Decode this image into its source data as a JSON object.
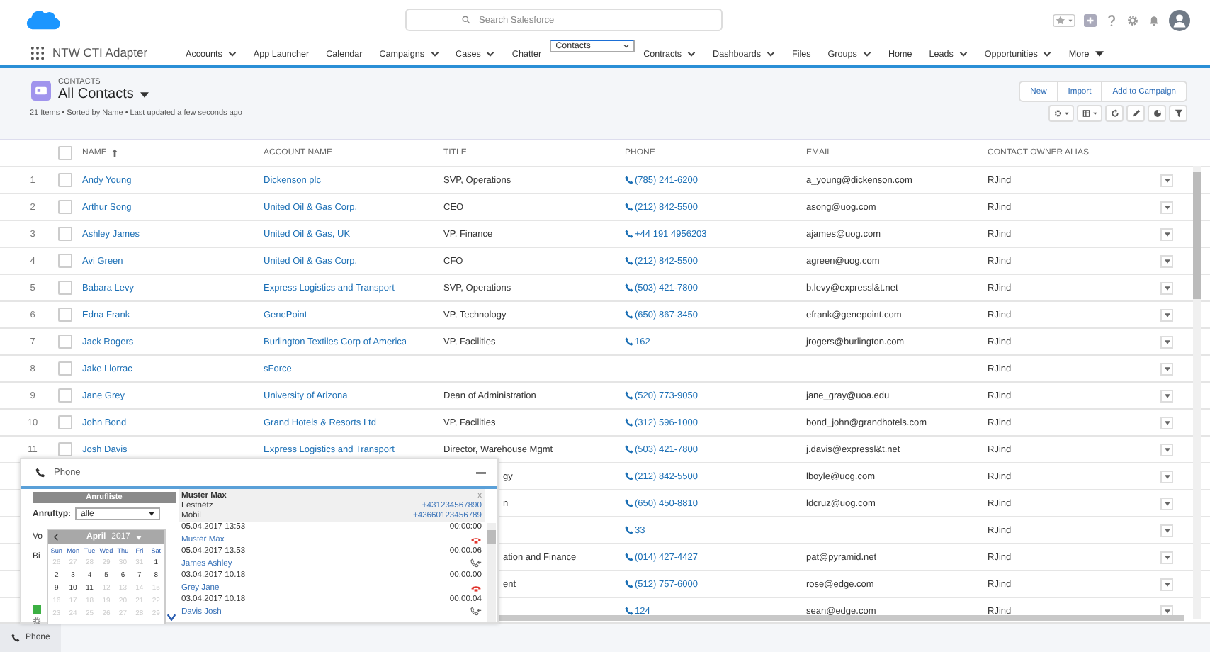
{
  "header": {
    "search": {
      "placeholder": "Search Salesforce"
    }
  },
  "nav": {
    "app_name": "NTW CTI Adapter",
    "items": [
      {
        "label": "Accounts",
        "menu": true,
        "selected": false
      },
      {
        "label": "App Launcher",
        "menu": false,
        "selected": false
      },
      {
        "label": "Calendar",
        "menu": false,
        "selected": false
      },
      {
        "label": "Campaigns",
        "menu": true,
        "selected": false
      },
      {
        "label": "Cases",
        "menu": true,
        "selected": false
      },
      {
        "label": "Chatter",
        "menu": false,
        "selected": false
      },
      {
        "label": "Contacts",
        "menu": true,
        "selected": true
      },
      {
        "label": "Contracts",
        "menu": true,
        "selected": false
      },
      {
        "label": "Dashboards",
        "menu": true,
        "selected": false
      },
      {
        "label": "Files",
        "menu": false,
        "selected": false
      },
      {
        "label": "Groups",
        "menu": true,
        "selected": false
      },
      {
        "label": "Home",
        "menu": false,
        "selected": false
      },
      {
        "label": "Leads",
        "menu": true,
        "selected": false
      },
      {
        "label": "Opportunities",
        "menu": true,
        "selected": false
      }
    ],
    "more": "More"
  },
  "list_header": {
    "object": "CONTACTS",
    "view": "All Contacts",
    "buttons": [
      "New",
      "Import",
      "Add to Campaign"
    ],
    "summary": "21 Items • Sorted by Name • Last updated a few seconds ago"
  },
  "table": {
    "columns": [
      "NAME",
      "ACCOUNT NAME",
      "TITLE",
      "PHONE",
      "EMAIL",
      "CONTACT OWNER ALIAS"
    ],
    "select_all_checked": false,
    "rows": [
      {
        "num": "1",
        "name": "Andy Young",
        "account": "Dickenson plc",
        "title": "SVP, Operations",
        "phone": "(785) 241-6200",
        "email": "a_young@dickenson.com",
        "alias": "RJind",
        "checked": false
      },
      {
        "num": "2",
        "name": "Arthur Song",
        "account": "United Oil & Gas Corp.",
        "title": "CEO",
        "phone": "(212) 842-5500",
        "email": "asong@uog.com",
        "alias": "RJind",
        "checked": false
      },
      {
        "num": "3",
        "name": "Ashley James",
        "account": "United Oil & Gas, UK",
        "title": "VP, Finance",
        "phone": "+44 191 4956203",
        "email": "ajames@uog.com",
        "alias": "RJind",
        "checked": false
      },
      {
        "num": "4",
        "name": "Avi Green",
        "account": "United Oil & Gas Corp.",
        "title": "CFO",
        "phone": "(212) 842-5500",
        "email": "agreen@uog.com",
        "alias": "RJind",
        "checked": false
      },
      {
        "num": "5",
        "name": "Babara Levy",
        "account": "Express Logistics and Transport",
        "title": "SVP, Operations",
        "phone": "(503) 421-7800",
        "email": "b.levy@expressl&t.net",
        "alias": "RJind",
        "checked": false
      },
      {
        "num": "6",
        "name": "Edna Frank",
        "account": "GenePoint",
        "title": "VP, Technology",
        "phone": "(650) 867-3450",
        "email": "efrank@genepoint.com",
        "alias": "RJind",
        "checked": false
      },
      {
        "num": "7",
        "name": "Jack Rogers",
        "account": "Burlington Textiles Corp of America",
        "title": "VP, Facilities",
        "phone": "162",
        "email": "jrogers@burlington.com",
        "alias": "RJind",
        "checked": false
      },
      {
        "num": "8",
        "name": "Jake Llorrac",
        "account": "sForce",
        "alias": "RJind",
        "checked": false
      },
      {
        "num": "9",
        "name": "Jane Grey",
        "account": "University of Arizona",
        "title": "Dean of Administration",
        "phone": "(520) 773-9050",
        "email": "jane_gray@uoa.edu",
        "alias": "RJind",
        "checked": false
      },
      {
        "num": "10",
        "name": "John Bond",
        "account": "Grand Hotels & Resorts Ltd",
        "title": "VP, Facilities",
        "phone": "(312) 596-1000",
        "email": "bond_john@grandhotels.com",
        "alias": "RJind",
        "checked": false
      },
      {
        "num": "11",
        "name": "Josh Davis",
        "account": "Express Logistics and Transport",
        "title": "Director, Warehouse Mgmt",
        "phone": "(503) 421-7800",
        "email": "j.davis@expressl&t.net",
        "alias": "RJind",
        "checked": false
      },
      {
        "title": "gy",
        "phone": "(212) 842-5500",
        "email": "lboyle@uog.com",
        "alias": "RJind"
      },
      {
        "title": "n",
        "phone": "(650) 450-8810",
        "email": "ldcruz@uog.com",
        "alias": "RJind"
      },
      {
        "phone": "33",
        "alias": "RJind"
      },
      {
        "title": "ation and Finance",
        "phone": "(014) 427-4427",
        "email": "pat@pyramid.net",
        "alias": "RJind"
      },
      {
        "title": "ent",
        "phone": "(512) 757-6000",
        "email": "rose@edge.com",
        "alias": "RJind"
      },
      {
        "phone": "124",
        "email": "sean@edge.com",
        "alias": "RJind"
      }
    ]
  },
  "phone_panel": {
    "title": "Phone",
    "call_list": {
      "title": "Anrufliste",
      "type_label": "Anruftyp:",
      "type_value": "alle",
      "from_label": "Vo",
      "to_label": "Bi"
    },
    "calendar": {
      "month": "April",
      "year": "2017",
      "weekdays": [
        "Sun",
        "Mon",
        "Tue",
        "Wed",
        "Thu",
        "Fri",
        "Sat"
      ],
      "days": [
        {
          "d": "26",
          "muted": true
        },
        {
          "d": "27",
          "muted": true
        },
        {
          "d": "28",
          "muted": true
        },
        {
          "d": "29",
          "muted": true
        },
        {
          "d": "30",
          "muted": true
        },
        {
          "d": "31",
          "muted": true
        },
        {
          "d": "1",
          "muted": false
        },
        {
          "d": "2",
          "muted": false
        },
        {
          "d": "3",
          "muted": false
        },
        {
          "d": "4",
          "muted": false
        },
        {
          "d": "5",
          "muted": false
        },
        {
          "d": "6",
          "muted": false
        },
        {
          "d": "7",
          "muted": false
        },
        {
          "d": "8",
          "muted": false
        },
        {
          "d": "9",
          "muted": false
        },
        {
          "d": "10",
          "muted": false
        },
        {
          "d": "11",
          "muted": false
        },
        {
          "d": "12",
          "muted": true
        },
        {
          "d": "13",
          "muted": true
        },
        {
          "d": "14",
          "muted": true
        },
        {
          "d": "15",
          "muted": true
        },
        {
          "d": "16",
          "muted": true
        },
        {
          "d": "17",
          "muted": true
        },
        {
          "d": "18",
          "muted": true
        },
        {
          "d": "19",
          "muted": true
        },
        {
          "d": "20",
          "muted": true
        },
        {
          "d": "21",
          "muted": true
        },
        {
          "d": "22",
          "muted": true
        },
        {
          "d": "23",
          "muted": true
        },
        {
          "d": "24",
          "muted": true
        },
        {
          "d": "25",
          "muted": true
        },
        {
          "d": "26",
          "muted": true
        },
        {
          "d": "27",
          "muted": true
        },
        {
          "d": "28",
          "muted": true
        },
        {
          "d": "29",
          "muted": true
        }
      ]
    },
    "contact": {
      "name": "Muster Max",
      "close": "x",
      "numbers": [
        {
          "label": "Festnetz",
          "value": "+431234567890"
        },
        {
          "label": "Mobil",
          "value": "+43660123456789"
        }
      ]
    },
    "calls": [
      {
        "date": "05.04.2017 13:53",
        "duration": "00:00:00",
        "name": "Muster Max",
        "kind": "missed"
      },
      {
        "date": "05.04.2017 13:53",
        "duration": "00:00:06",
        "name": "James Ashley",
        "kind": "incoming"
      },
      {
        "date": "03.04.2017 10:18",
        "duration": "00:00:00",
        "name": "Grey Jane",
        "kind": "missed"
      },
      {
        "date": "03.04.2017 10:18",
        "duration": "00:00:04",
        "name": "Davis Josh",
        "kind": "incoming"
      }
    ]
  },
  "utility_bar": {
    "label": "Phone"
  }
}
